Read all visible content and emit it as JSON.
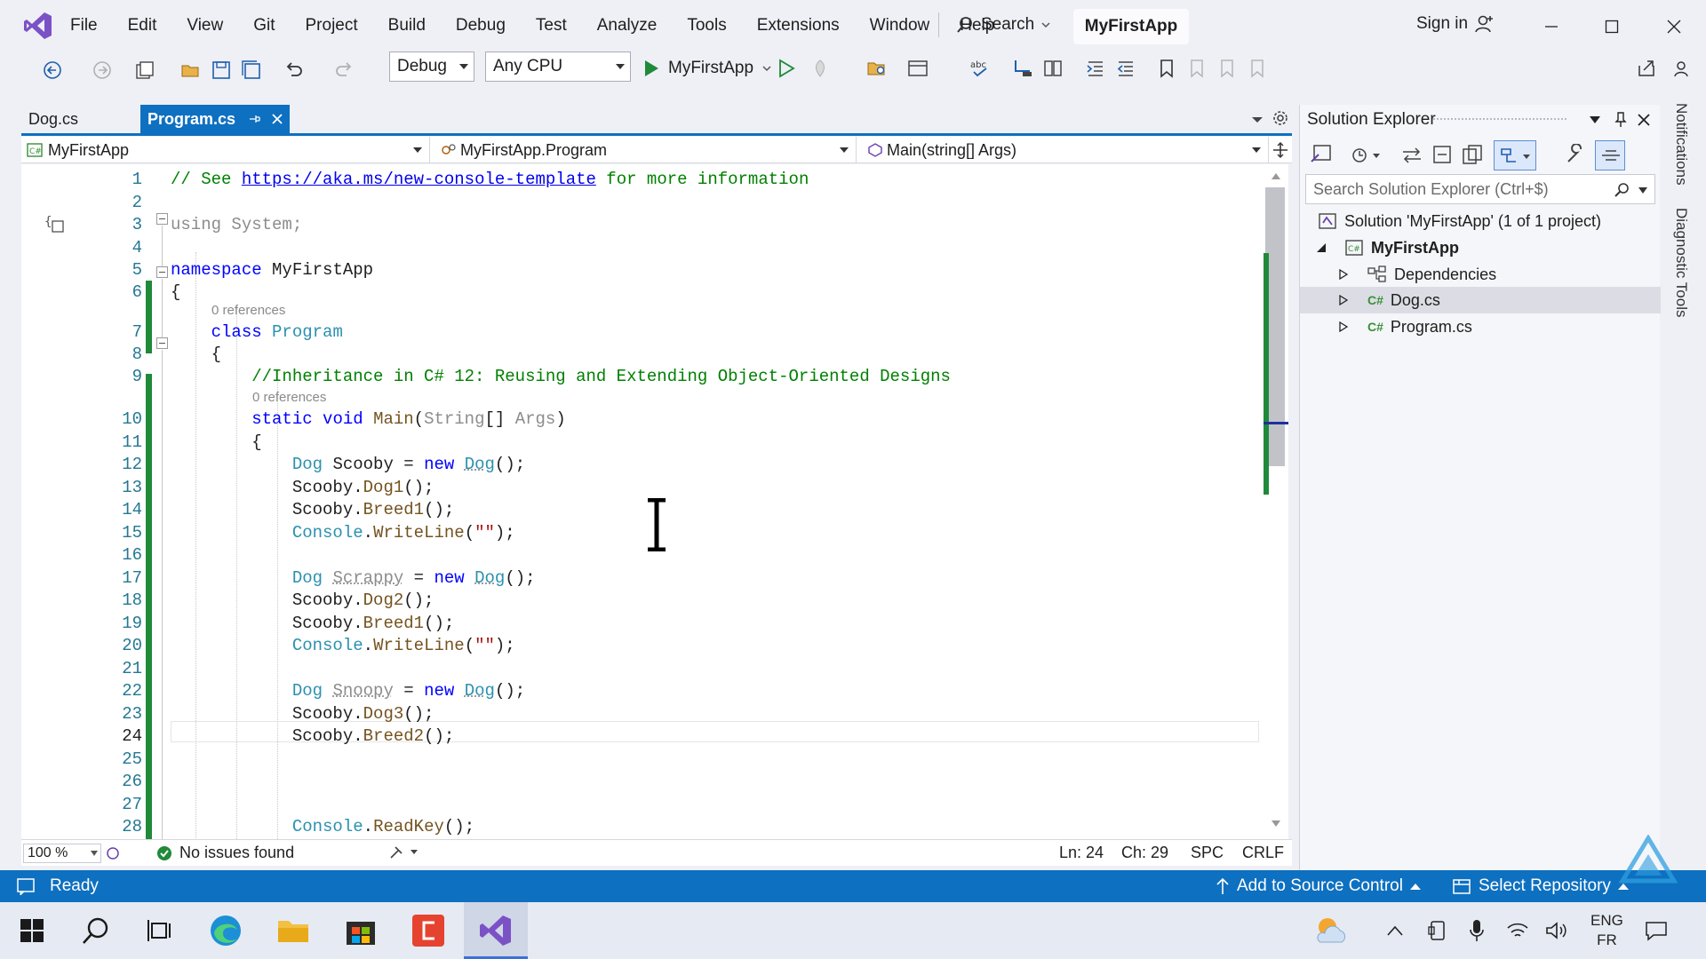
{
  "menu": {
    "items": [
      "File",
      "Edit",
      "View",
      "Git",
      "Project",
      "Build",
      "Debug",
      "Test",
      "Analyze",
      "Tools",
      "Extensions",
      "Window",
      "Help"
    ],
    "search_label": "Search",
    "solution_title": "MyFirstApp",
    "sign_in": "Sign in"
  },
  "toolbar": {
    "config": "Debug",
    "platform": "Any CPU",
    "run_target": "MyFirstApp"
  },
  "tabs": [
    {
      "label": "Dog.cs",
      "active": false
    },
    {
      "label": "Program.cs",
      "active": true
    }
  ],
  "navbar": {
    "project": "MyFirstApp",
    "type": "MyFirstApp.Program",
    "member": "Main(string[] Args)"
  },
  "editor": {
    "lens_refs": "0 references",
    "lines": [
      {
        "n": "1",
        "text": "// See https://aka.ms/new-console-template for more information"
      },
      {
        "n": "2",
        "text": ""
      },
      {
        "n": "3",
        "text": "using System;"
      },
      {
        "n": "4",
        "text": ""
      },
      {
        "n": "5",
        "text": "namespace MyFirstApp"
      },
      {
        "n": "6",
        "text": "{"
      },
      {
        "n": "7",
        "text": "    class Program"
      },
      {
        "n": "8",
        "text": "    {"
      },
      {
        "n": "9",
        "text": "        //Inheritance in C# 12: Reusing and Extending Object-Oriented Designs"
      },
      {
        "n": "10",
        "text": "        static void Main(String[] Args)"
      },
      {
        "n": "11",
        "text": "        {"
      },
      {
        "n": "12",
        "text": "            Dog Scooby = new Dog();"
      },
      {
        "n": "13",
        "text": "            Scooby.Dog1();"
      },
      {
        "n": "14",
        "text": "            Scooby.Breed1();"
      },
      {
        "n": "15",
        "text": "            Console.WriteLine(\"\");"
      },
      {
        "n": "16",
        "text": ""
      },
      {
        "n": "17",
        "text": "            Dog Scrappy = new Dog();"
      },
      {
        "n": "18",
        "text": "            Scooby.Dog2();"
      },
      {
        "n": "19",
        "text": "            Scooby.Breed1();"
      },
      {
        "n": "20",
        "text": "            Console.WriteLine(\"\");"
      },
      {
        "n": "21",
        "text": ""
      },
      {
        "n": "22",
        "text": "            Dog Snoopy = new Dog();"
      },
      {
        "n": "23",
        "text": "            Scooby.Dog3();"
      },
      {
        "n": "24",
        "text": "            Scooby.Breed2();"
      },
      {
        "n": "25",
        "text": ""
      },
      {
        "n": "26",
        "text": ""
      },
      {
        "n": "27",
        "text": ""
      },
      {
        "n": "28",
        "text": "            Console.ReadKey();"
      }
    ],
    "url": "https://aka.ms/new-console-template",
    "active_line": "24"
  },
  "editor_status": {
    "zoom": "100 %",
    "issues": "No issues found",
    "ln": "Ln: 24",
    "ch": "Ch: 29",
    "spc": "SPC",
    "eol": "CRLF"
  },
  "solution_explorer": {
    "title": "Solution Explorer",
    "search_placeholder": "Search Solution Explorer (Ctrl+$)",
    "solution": "Solution 'MyFirstApp' (1 of 1 project)",
    "project": "MyFirstApp",
    "items": [
      "Dependencies",
      "Dog.cs",
      "Program.cs"
    ],
    "selected": "Dog.cs",
    "cs_badge": "C#"
  },
  "side_rail": {
    "notifications": "Notifications",
    "diagnostic_tools": "Diagnostic Tools"
  },
  "statusbar": {
    "ready": "Ready",
    "source_control": "Add to Source Control",
    "select_repo": "Select Repository"
  },
  "taskbar": {
    "lang_line1": "ENG",
    "lang_line2": "FR"
  },
  "colors": {
    "accent": "#0e70c0",
    "change_bar": "#1f8a3a",
    "vs_purple": "#7b52c6"
  }
}
